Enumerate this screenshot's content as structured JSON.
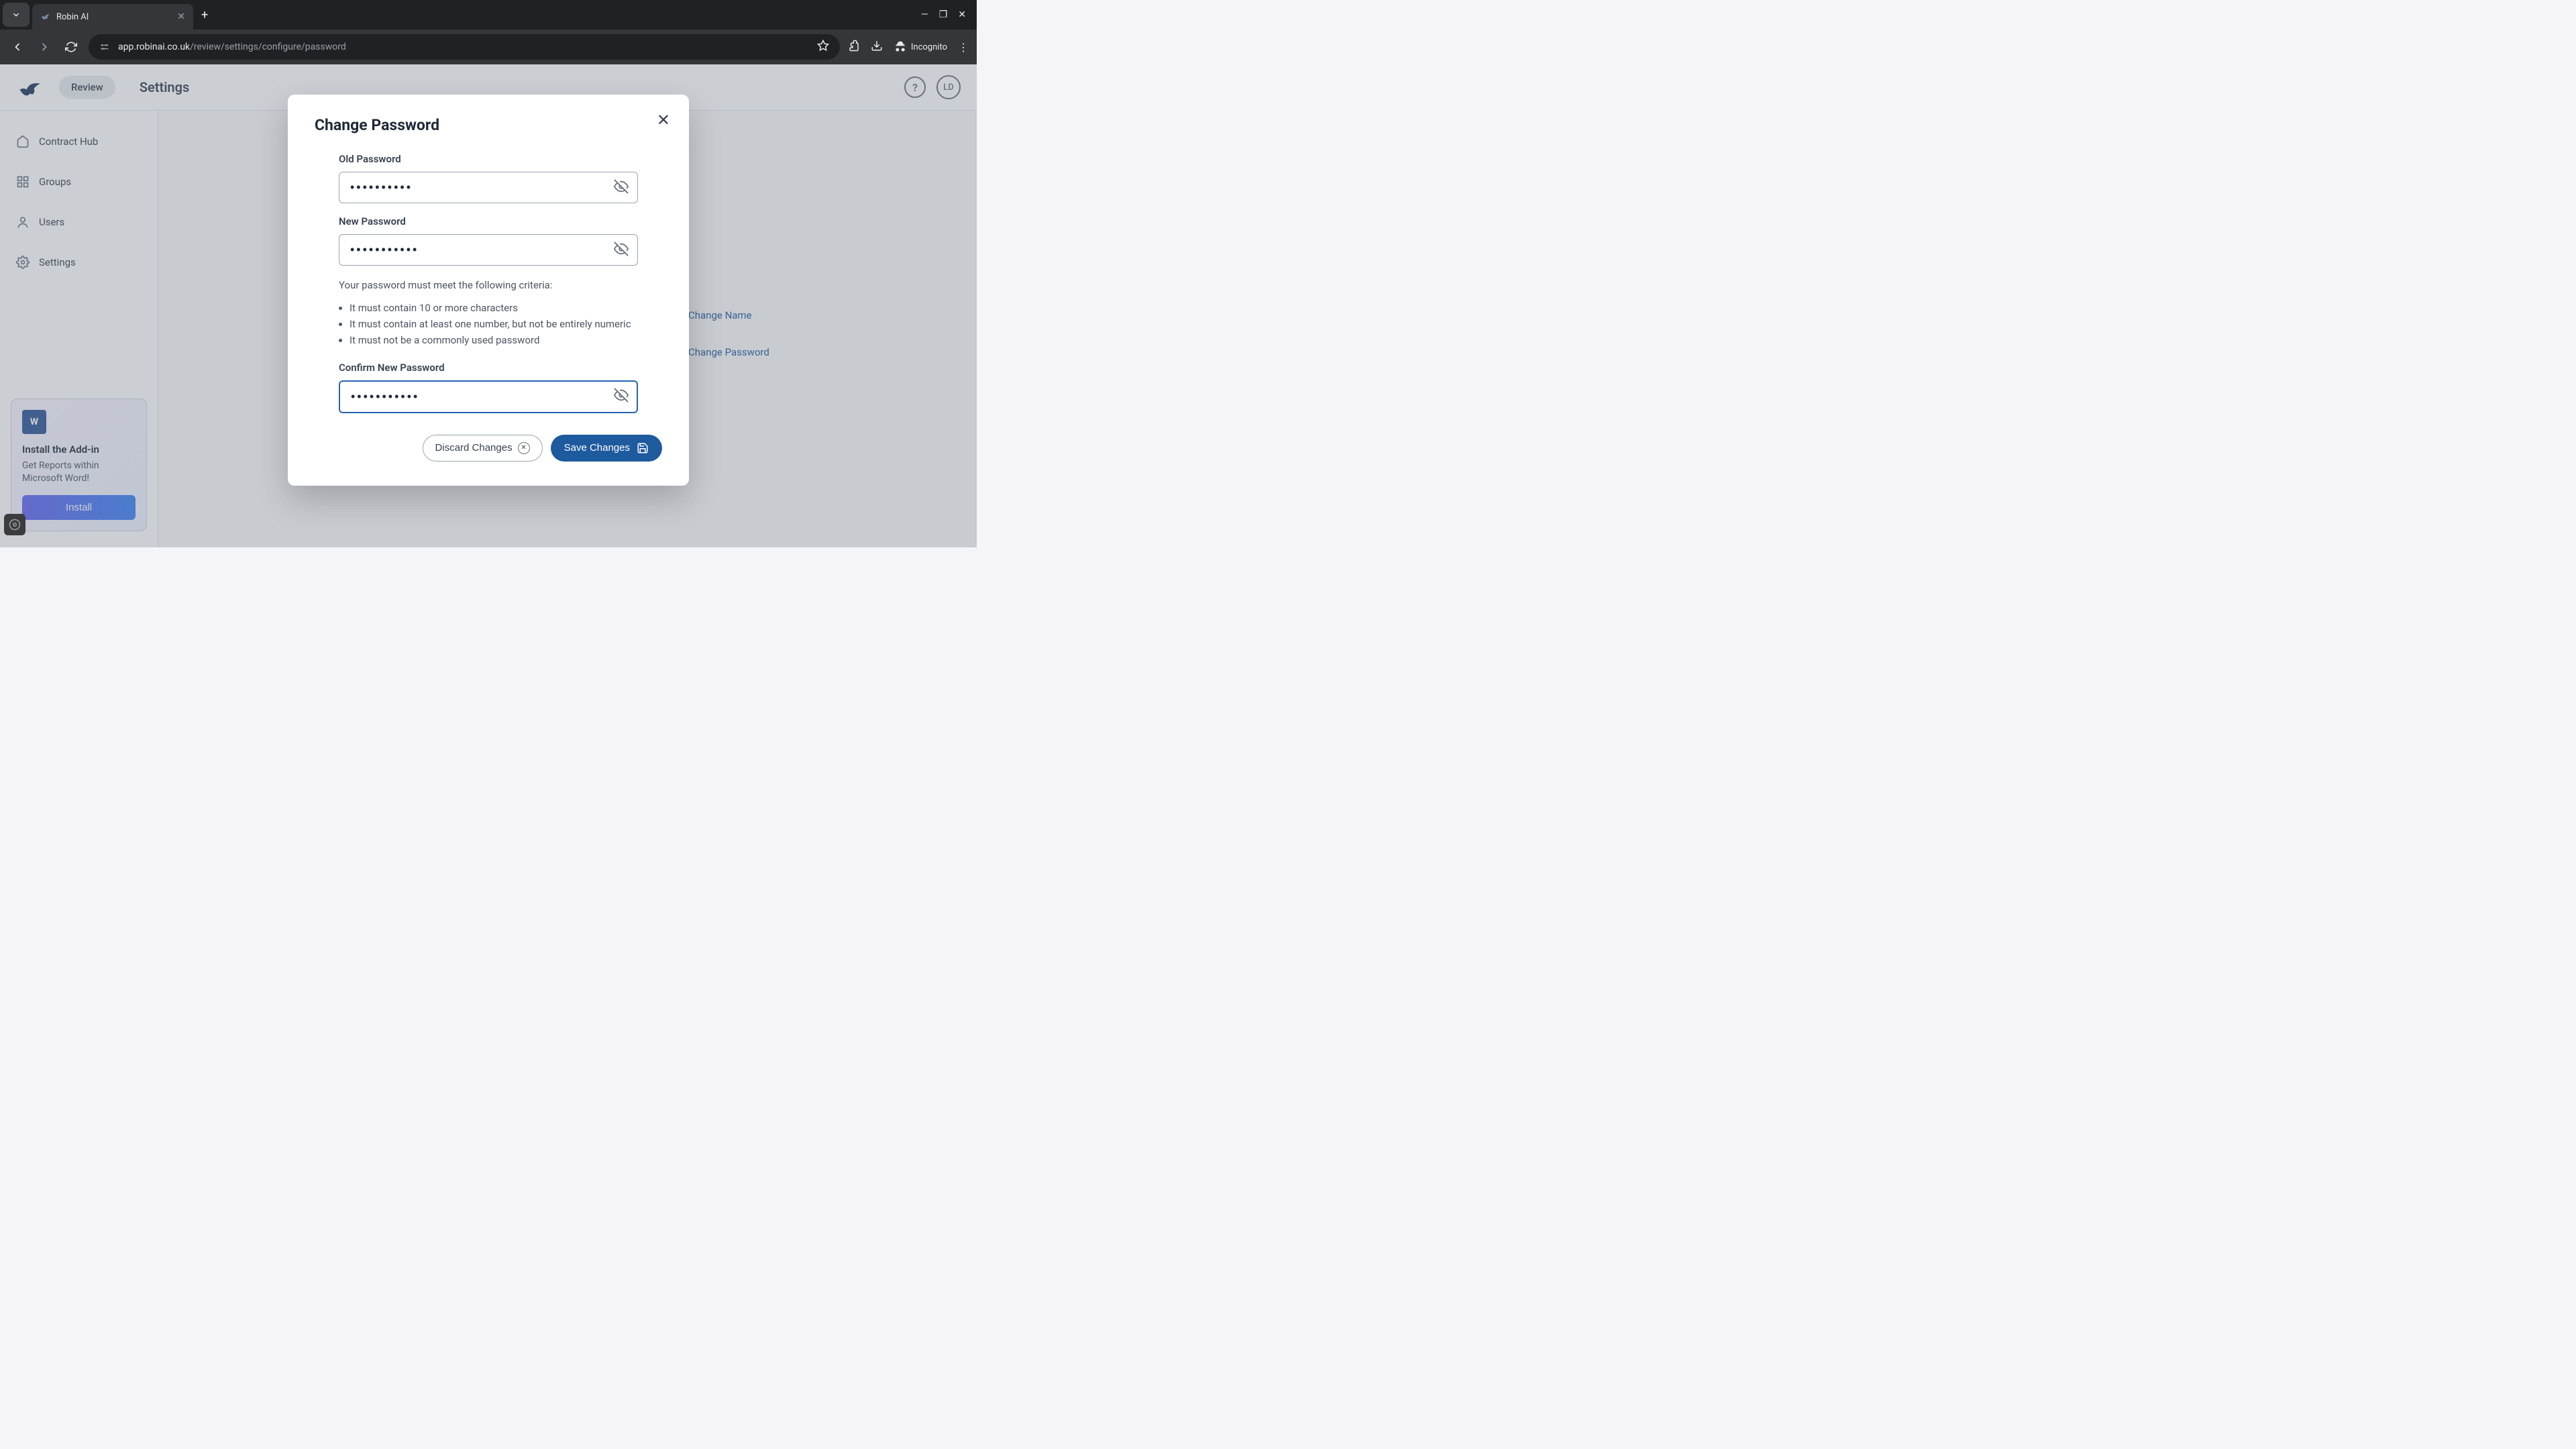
{
  "browser": {
    "tab_title": "Robin AI",
    "url_domain": "app.robinai.co.uk",
    "url_path": "/review/settings/configure/password",
    "incognito_label": "Incognito"
  },
  "header": {
    "review_label": "Review",
    "page_title": "Settings",
    "avatar_initials": "LD",
    "help_label": "?"
  },
  "sidebar": {
    "items": [
      {
        "label": "Contract Hub"
      },
      {
        "label": "Groups"
      },
      {
        "label": "Users"
      },
      {
        "label": "Settings"
      }
    ],
    "addon": {
      "title": "Install the Add-in",
      "desc": "Get Reports within Microsoft Word!",
      "button": "Install",
      "icon_text": "W"
    }
  },
  "background_links": {
    "change_name": "Change Name",
    "change_password": "Change Password"
  },
  "modal": {
    "title": "Change Password",
    "old_password_label": "Old Password",
    "old_password_value": "••••••••••",
    "new_password_label": "New Password",
    "new_password_value": "•••••••••••",
    "criteria_intro": "Your password must meet the following criteria:",
    "criteria": [
      "It must contain 10 or more characters",
      "It must contain at least one number, but not be entirely numeric",
      "It must not be a commonly used password"
    ],
    "confirm_label": "Confirm New Password",
    "confirm_value": "•••••••••••",
    "discard_label": "Discard Changes",
    "save_label": "Save Changes"
  }
}
